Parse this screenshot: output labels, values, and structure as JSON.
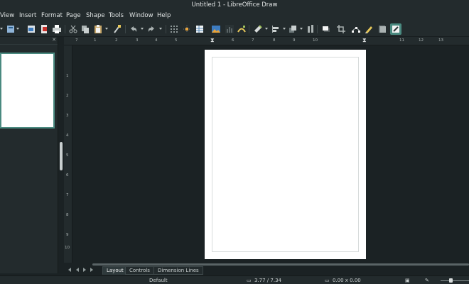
{
  "window": {
    "title": "Untitled 1 - LibreOffice Draw"
  },
  "menubar": {
    "items": [
      "View",
      "Insert",
      "Format",
      "Page",
      "Shape",
      "Tools",
      "Window",
      "Help"
    ]
  },
  "toolbar": {
    "icons": [
      "new-icon",
      "templates-icon",
      "export-pdf-icon",
      "print-icon",
      "cut-icon",
      "copy-icon",
      "paste-icon",
      "clone-formatting-icon",
      "undo-icon",
      "redo-icon",
      "grid-icon",
      "helplines-icon",
      "image-icon",
      "shapes-icon",
      "fontwork-icon",
      "transform-icon",
      "align-icon",
      "arrange-icon",
      "distribute-icon",
      "shadow-icon",
      "crop-icon",
      "points-icon",
      "glue-points-icon",
      "toggle-extrusion-icon",
      "show-draw-functions-icon"
    ],
    "active": "show-draw-functions-icon"
  },
  "ruler": {
    "horizontal": [
      "7",
      "1",
      "2",
      "3",
      "4",
      "5",
      "6",
      "7",
      "8",
      "9",
      "10",
      "11",
      "12",
      "13"
    ],
    "vertical": [
      "1",
      "2",
      "3",
      "4",
      "5",
      "6",
      "7",
      "8",
      "9",
      "10"
    ]
  },
  "tabs": [
    "Layout",
    "Controls",
    "Dimension Lines"
  ],
  "active_tab": "Layout",
  "statusbar": {
    "page_style": "Default",
    "position": "3.77 / 7.34",
    "size": "0.00 x 0.00"
  },
  "colors": {
    "accent": "#4a8a80",
    "background": "#1b2224",
    "chrome": "#232b2d"
  }
}
